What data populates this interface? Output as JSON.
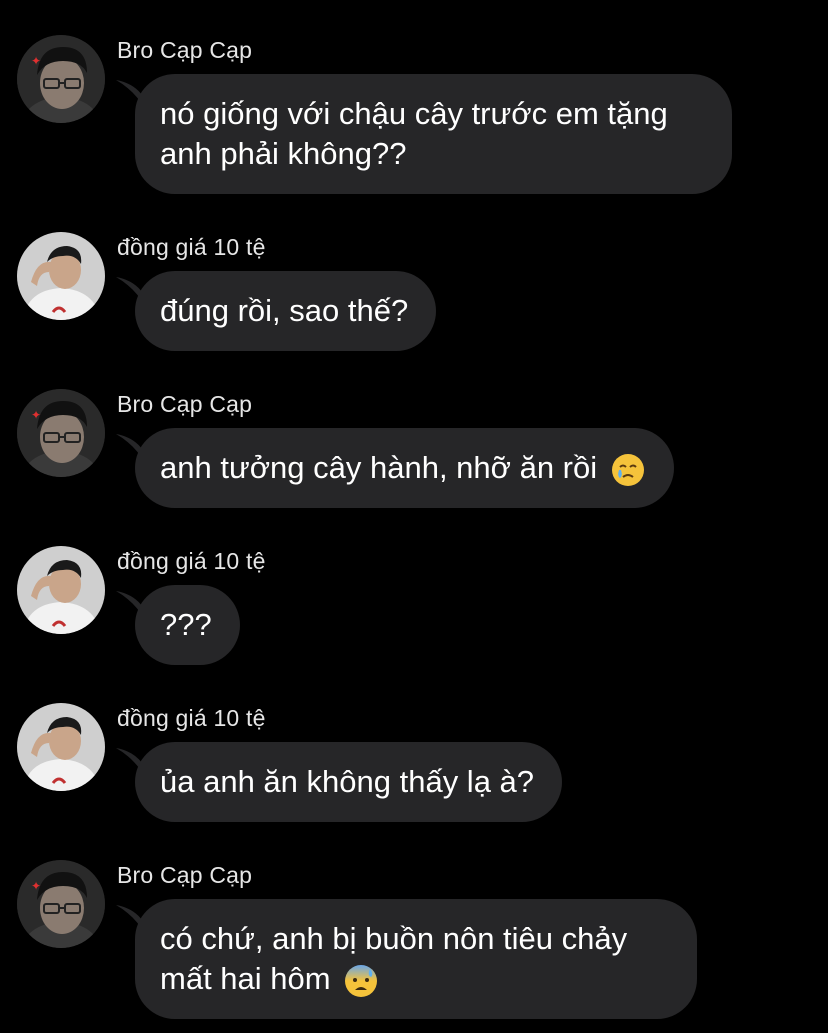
{
  "conversation": [
    {
      "sender": "Bro Cạp Cạp",
      "avatar": "avatar-glasses",
      "lines": [
        "nó giống với chậu cây trước em tặng",
        "anh phải không??"
      ],
      "emoji": ""
    },
    {
      "sender": "đồng giá 10 tệ",
      "avatar": "avatar-white-shirt",
      "lines": [
        "đúng rồi, sao thế?"
      ],
      "emoji": ""
    },
    {
      "sender": "Bro Cạp Cạp",
      "avatar": "avatar-glasses",
      "lines": [
        "anh tưởng cây hành, nhỡ ăn rồi"
      ],
      "emoji": "face-holding-back-tears-emoji"
    },
    {
      "sender": "đồng giá 10 tệ",
      "avatar": "avatar-white-shirt",
      "lines": [
        "???"
      ],
      "emoji": ""
    },
    {
      "sender": "đồng giá 10 tệ",
      "avatar": "avatar-white-shirt",
      "lines": [
        "ủa anh ăn không thấy lạ à?"
      ],
      "emoji": ""
    },
    {
      "sender": "Bro Cạp Cạp",
      "avatar": "avatar-glasses",
      "lines": [
        "có chứ, anh bị buồn nôn tiêu chảy",
        "mất hai hôm"
      ],
      "emoji": "anxious-face-with-sweat-emoji"
    }
  ],
  "colors": {
    "background": "#000000",
    "bubble": "#262628",
    "text": "#ffffff",
    "sender": "#e6e6e6"
  }
}
